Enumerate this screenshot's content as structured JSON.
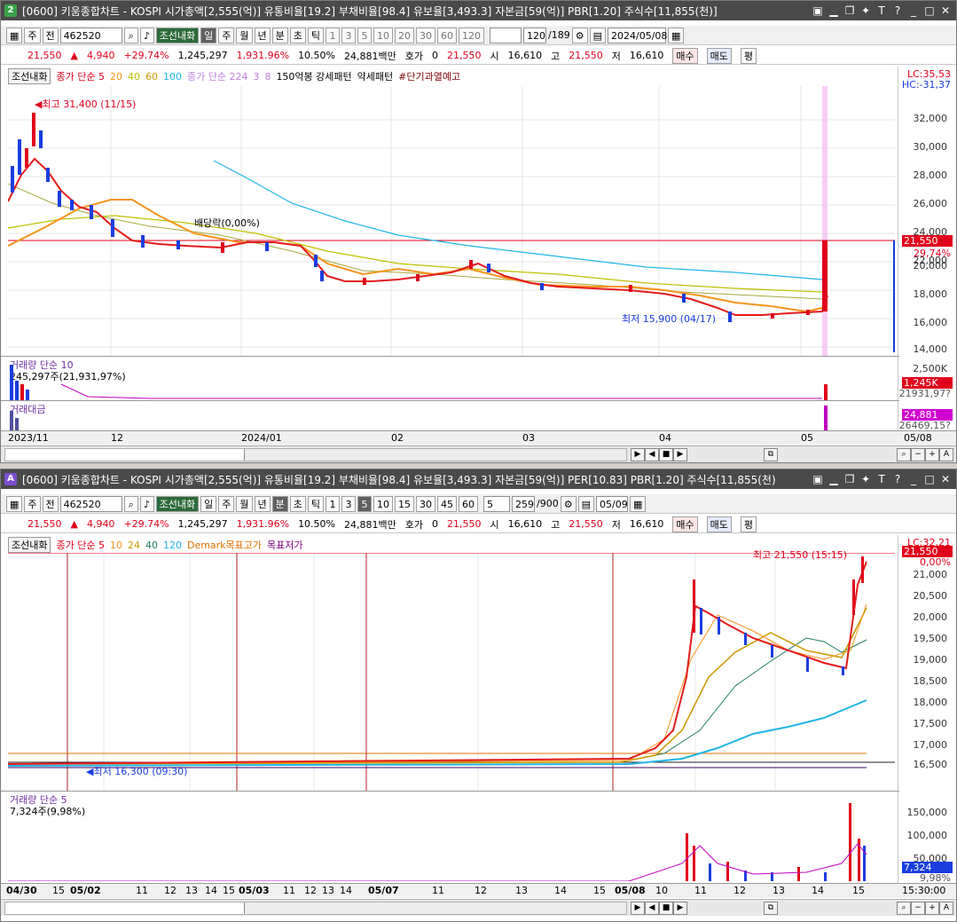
{
  "top": {
    "badge": "2",
    "title": "[0600] 키움종합차트 - KOSPI 시가총액[2,555(억)] 유통비율[19.2] 부채비율[98.4] 유보율[3,493.3] 자본금[59(억)] PBR[1.20] 주식수[11,855(천)]",
    "toolbar": {
      "type_label": "주",
      "view_label": "전",
      "code": "462520",
      "stock_name": "조선내화",
      "periods": [
        "일",
        "주",
        "월",
        "년",
        "분",
        "초",
        "틱"
      ],
      "intervals": [
        "1",
        "3",
        "5",
        "10",
        "20",
        "30",
        "60",
        "120"
      ],
      "count": "120",
      "count_total": "/189",
      "date": "2024/05/08"
    },
    "info": {
      "price": "21,550",
      "change": "4,940",
      "rate": "+29.74%",
      "volume": "1,245,297",
      "vol_rate": "1,931.96%",
      "turnover": "10.50%",
      "amount": "24,881백만",
      "hoga_label": "호가",
      "hoga": "0",
      "ask": "21,550",
      "open_label": "시",
      "open": "16,610",
      "high_label": "고",
      "high": "21,550",
      "low_label": "저",
      "low": "16,610",
      "buy": "매수",
      "sell": "매도",
      "avg": "평"
    },
    "legend": {
      "name": "조선내화",
      "ma1": "종가 단순 5",
      "ma_vals": [
        "20",
        "40",
        "60",
        "100"
      ],
      "ma2": "종가 단순 224",
      "ma2_vals": [
        "3",
        "8"
      ],
      "pattern": "150억봉 강세패턴",
      "weak": "약세패턴",
      "warn": "#단기과열예고"
    },
    "y_axis": [
      "32,000",
      "30,000",
      "28,000",
      "26,000",
      "24,000",
      "22,000",
      "20,000",
      "18,000",
      "16,000",
      "14,000"
    ],
    "tags": {
      "lc": "LC:35,53",
      "hc": "HC:-31,37",
      "last": "21,550",
      "pct": "29,74%"
    },
    "annotations": {
      "high": "최고 31,400 (11/15)",
      "dividend": "배당락(0,00%)",
      "low": "최저 15,900 (04/17)"
    },
    "volume": {
      "label": "거래량 단순 10",
      "value": "245,297주(21,931,97%)",
      "axis_top": "2,500K",
      "tag": "1,245K",
      "tag2": "21931,97?"
    },
    "amount_panel": {
      "label": "거래대금",
      "tag": "24,881",
      "tag2": "26469,15?"
    },
    "dates": [
      "2023/11",
      "12",
      "2024/01",
      "02",
      "03",
      "04",
      "05",
      "05/08"
    ]
  },
  "bottom": {
    "badge": "A",
    "title": "[0600] 키움종합차트 - KOSPI 시가총액[2,555(억)] 유통비율[19.2] 부채비율[98.4] 유보율[3,493.3] 자본금[59(억)] PER[10.83] PBR[1.20] 주식수[11,855(천)",
    "toolbar": {
      "type_label": "주",
      "view_label": "전",
      "code": "462520",
      "stock_name": "조선내화",
      "periods": [
        "일",
        "주",
        "월",
        "년",
        "분",
        "초",
        "틱"
      ],
      "intervals": [
        "1",
        "3",
        "5",
        "10",
        "15",
        "30",
        "45",
        "60"
      ],
      "interval_sel": "5",
      "count": "259",
      "count_total": "/900",
      "date": "05/09"
    },
    "info": {
      "price": "21,550",
      "change": "4,940",
      "rate": "+29.74%",
      "volume": "1,245,297",
      "vol_rate": "1,931.96%",
      "turnover": "10.50%",
      "amount": "24,881백만",
      "hoga_label": "호가",
      "hoga": "0",
      "ask": "21,550",
      "open_label": "시",
      "open": "16,610",
      "high_label": "고",
      "high": "21,550",
      "low_label": "저",
      "low": "16,610",
      "buy": "매수",
      "sell": "매도",
      "avg": "평"
    },
    "legend": {
      "name": "조선내화",
      "ma1": "종가 단순 5",
      "ma_vals": [
        "10",
        "24",
        "40",
        "120"
      ],
      "demark": "Demark목표고가",
      "demark_low": "목표저가"
    },
    "y_axis": [
      "21,000",
      "20,500",
      "20,000",
      "19,500",
      "19,000",
      "18,500",
      "18,000",
      "17,500",
      "17,000",
      "16,500"
    ],
    "tags": {
      "lc": "LC:32,21",
      "last": "21,550",
      "pct": "0,00%"
    },
    "annotations": {
      "high": "최고 21,550 (15:15)",
      "low": "최저 16,300 (09:30)"
    },
    "volume": {
      "label": "거래량 단순 5",
      "value": "7,324주(9,98%)",
      "axis": [
        "150,000",
        "100,000",
        "50,000"
      ],
      "tag": "7,324",
      "tag2": "9,98%"
    },
    "times": [
      "04/30",
      "15",
      "05/02",
      "11",
      "12",
      "13",
      "14",
      "15",
      "05/03",
      "11",
      "12",
      "13",
      "14",
      "05/07",
      "11",
      "12",
      "13",
      "14",
      "15",
      "05/08",
      "10",
      "11",
      "12",
      "13",
      "14",
      "15",
      "15:30:00"
    ]
  },
  "colors": {
    "up": "#e0001b",
    "down": "#1a3ddf",
    "ma5": "#e31b1b",
    "ma20": "#f7941d",
    "ma60": "#bfbf00",
    "ma120": "#21b6e6"
  }
}
